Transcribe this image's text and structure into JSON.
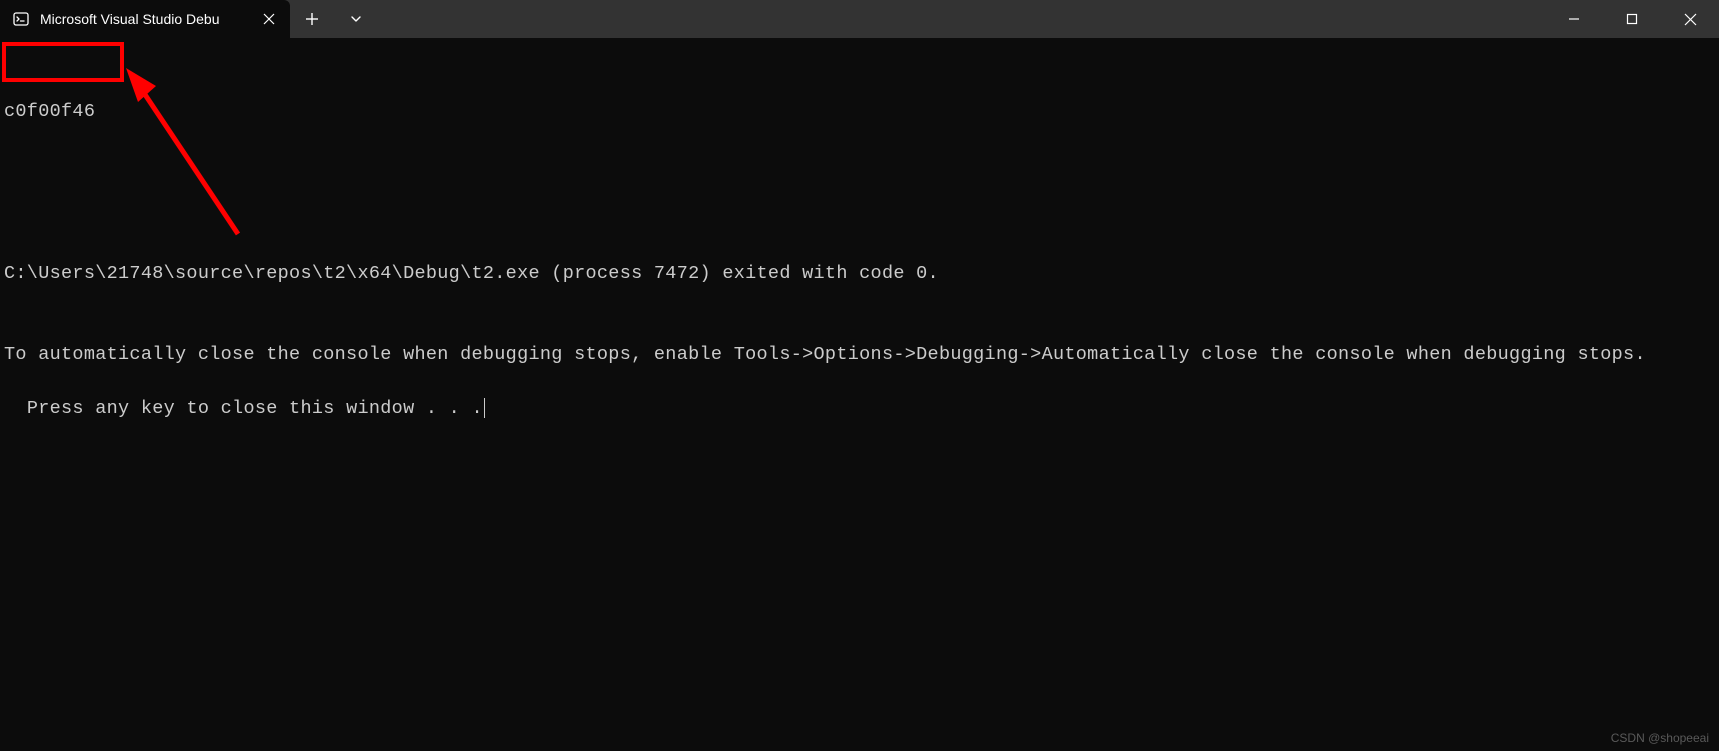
{
  "tab": {
    "title": "Microsoft Visual Studio Debu"
  },
  "console": {
    "line1": "c0f00f46",
    "line2": "C:\\Users\\21748\\source\\repos\\t2\\x64\\Debug\\t2.exe (process 7472) exited with code 0.",
    "line3": "To automatically close the console when debugging stops, enable Tools->Options->Debugging->Automatically close the console when debugging stops.",
    "line4": "Press any key to close this window . . ."
  },
  "watermark": "CSDN @shopeeai"
}
